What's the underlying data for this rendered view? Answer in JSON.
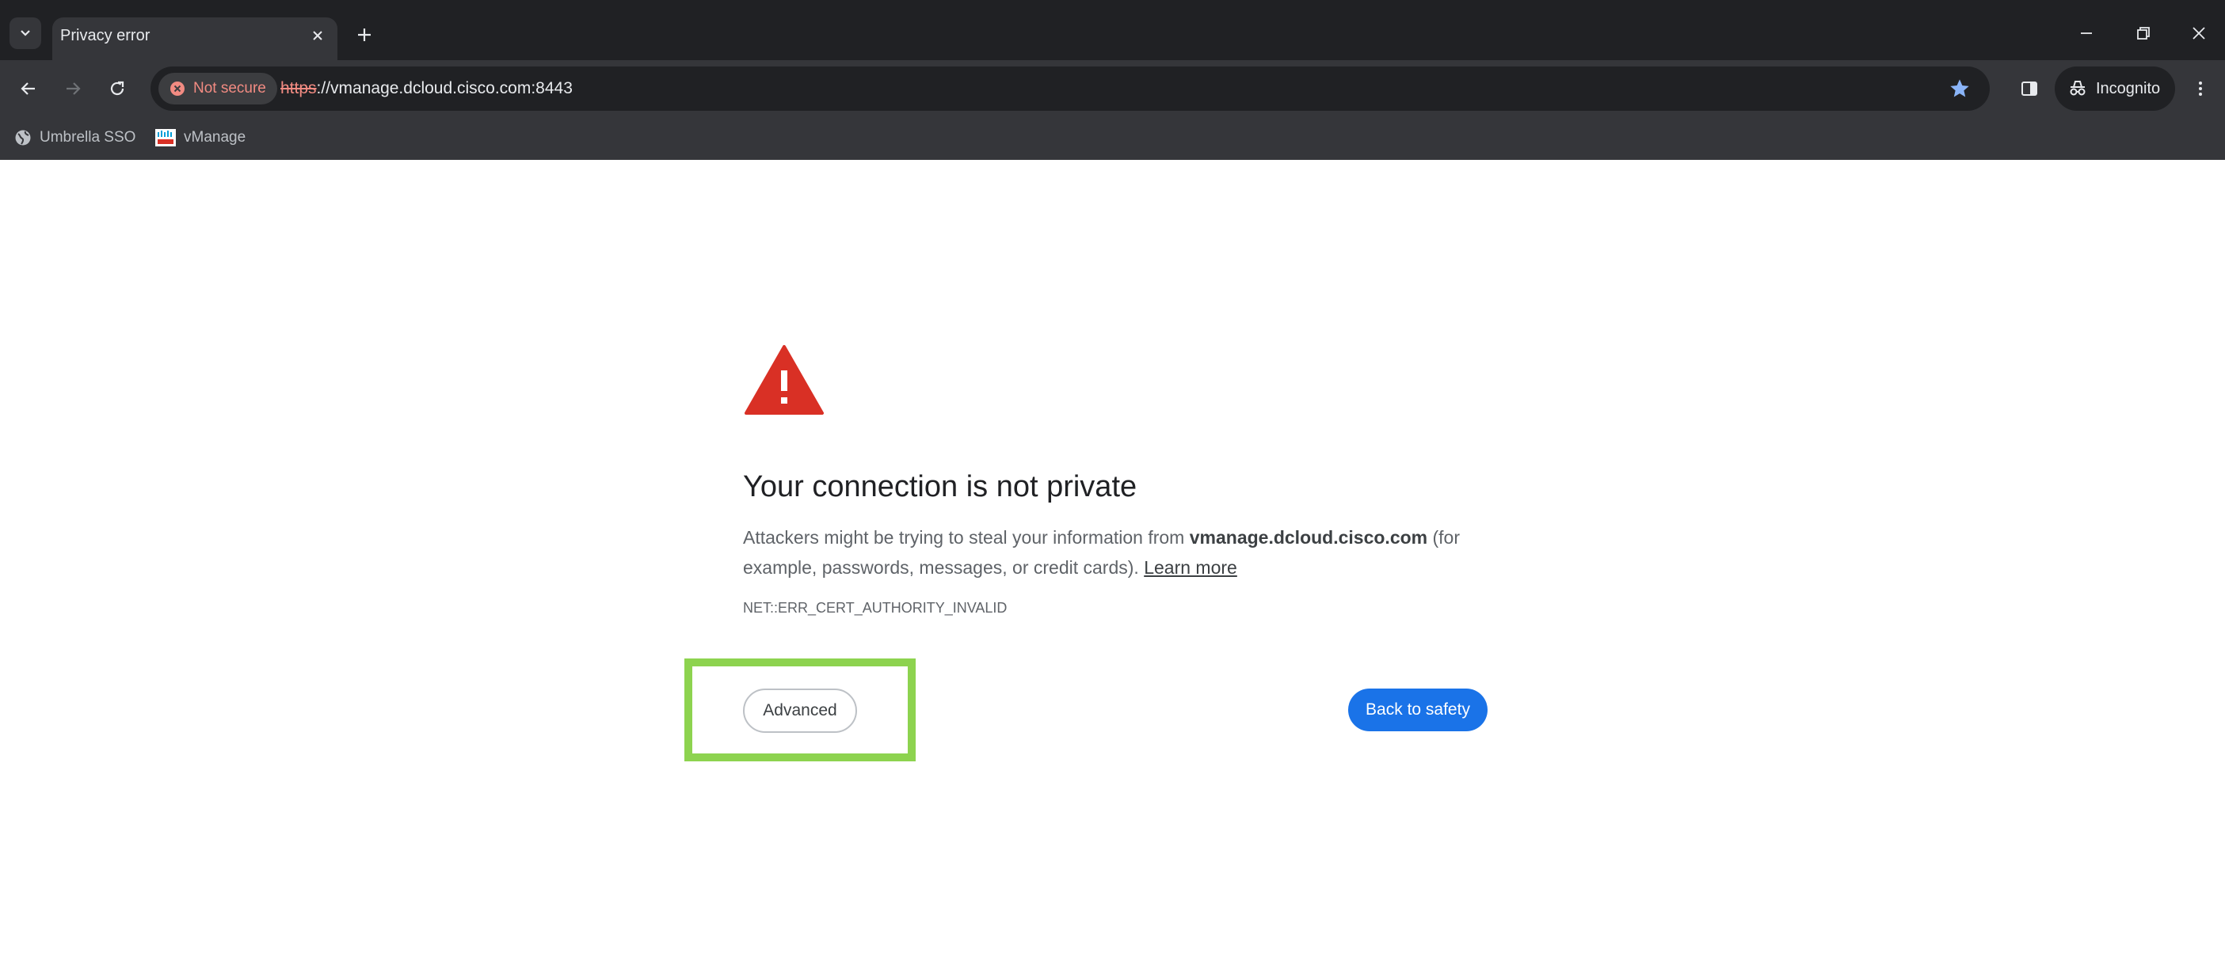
{
  "tabs": [
    {
      "title": "Privacy error"
    }
  ],
  "toolbar": {
    "security_chip": "Not secure",
    "url_scheme": "https",
    "url_rest": "://vmanage.dcloud.cisco.com:8443",
    "profile_label": "Incognito"
  },
  "bookmarks": [
    {
      "label": "Umbrella SSO",
      "icon": "globe-icon"
    },
    {
      "label": "vManage",
      "icon": "cisco-logo-icon"
    }
  ],
  "error_page": {
    "heading": "Your connection is not private",
    "body_prefix": "Attackers might be trying to steal your information from ",
    "domain": "vmanage.dcloud.cisco.com",
    "body_suffix": " (for example, passwords, messages, or credit cards). ",
    "learn_more": "Learn more",
    "error_code": "NET::ERR_CERT_AUTHORITY_INVALID",
    "advanced_label": "Advanced",
    "back_label": "Back to safety"
  },
  "colors": {
    "chrome_dark": "#202124",
    "toolbar": "#35363a",
    "warning_red": "#d93025",
    "primary_blue": "#1a73e8",
    "highlight_green": "#8dd34f"
  }
}
